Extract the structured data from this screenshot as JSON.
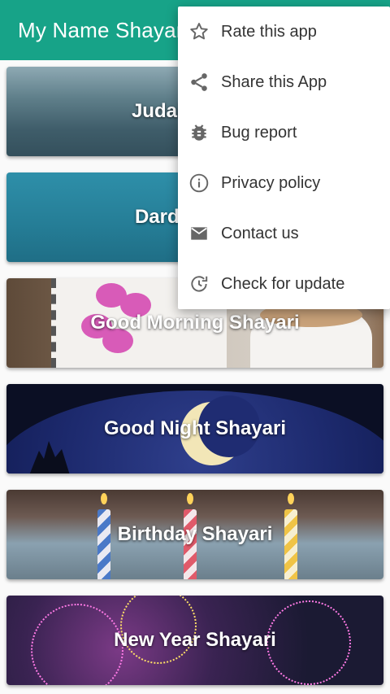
{
  "app_bar": {
    "title": "My Name Shayari"
  },
  "categories": [
    {
      "label": "Judai Shayari"
    },
    {
      "label": "Dard Shayari"
    },
    {
      "label": "Good Morning Shayari"
    },
    {
      "label": "Good Night Shayari"
    },
    {
      "label": "Birthday Shayari"
    },
    {
      "label": "New Year Shayari"
    }
  ],
  "overflow_menu": {
    "items": [
      {
        "label": "Rate this app",
        "icon": "star-outline-icon"
      },
      {
        "label": "Share this App",
        "icon": "share-icon"
      },
      {
        "label": "Bug report",
        "icon": "bug-icon"
      },
      {
        "label": "Privacy policy",
        "icon": "info-icon"
      },
      {
        "label": "Contact us",
        "icon": "mail-icon"
      },
      {
        "label": "Check for update",
        "icon": "update-icon"
      }
    ]
  },
  "colors": {
    "primary": "#17a388",
    "menu_background": "#ffffff",
    "menu_text": "#333333",
    "icon_gray": "#666666"
  }
}
